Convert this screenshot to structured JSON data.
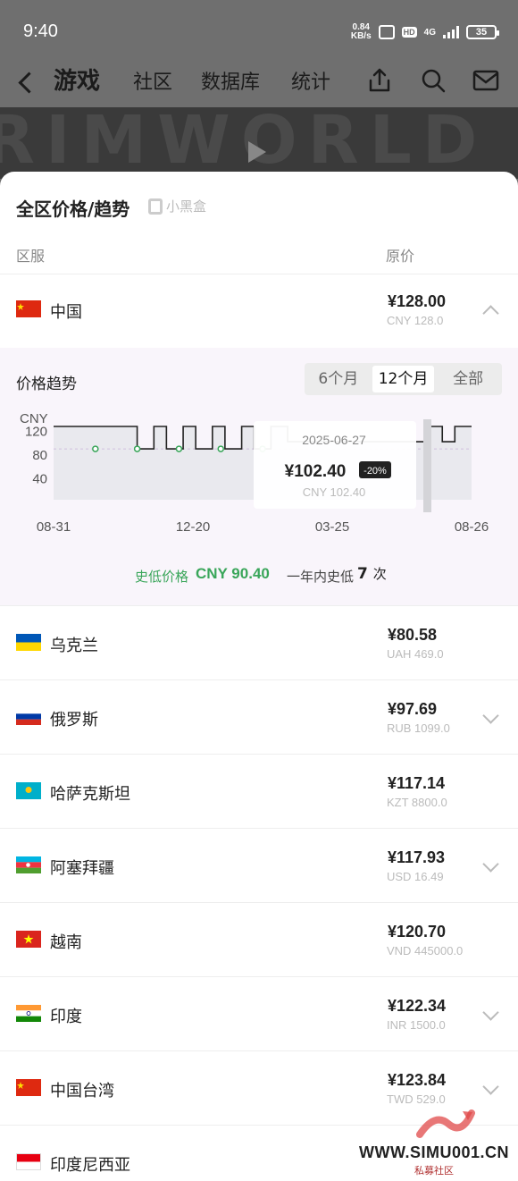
{
  "status_bar": {
    "time": "9:40",
    "net_speed_value": "0.84",
    "net_speed_unit": "KB/s",
    "network": "4G",
    "battery": "35"
  },
  "header": {
    "tabs": [
      {
        "label": "游戏",
        "active": true
      },
      {
        "label": "社区",
        "active": false
      },
      {
        "label": "数据库",
        "active": false
      },
      {
        "label": "统计",
        "active": false
      }
    ],
    "icons": [
      "share-icon",
      "search-icon",
      "mail-icon"
    ]
  },
  "banner": {
    "text": "RIMWORLD"
  },
  "sheet": {
    "title": "全区价格/趋势",
    "brand": "小黑盒",
    "col_region": "区服",
    "col_price": "原价"
  },
  "expanded_region": {
    "name": "中国",
    "price": "¥128.00",
    "orig": "CNY 128.0"
  },
  "trend": {
    "title": "价格趋势",
    "periods": [
      {
        "label": "6个月",
        "active": false
      },
      {
        "label": "12个月",
        "active": true
      },
      {
        "label": "全部",
        "active": false
      }
    ],
    "lowest_label": "史低价格",
    "lowest_value": "CNY 90.40",
    "count_label": "一年内史低",
    "count_value": "7",
    "count_unit": "次",
    "tooltip": {
      "date": "2025-06-27",
      "price": "¥102.40",
      "discount": "-20%",
      "orig": "CNY 102.40"
    }
  },
  "regions": [
    {
      "name": "乌克兰",
      "price": "¥80.58",
      "orig": "UAH 469.0",
      "flag": "ukraine",
      "chevron": false
    },
    {
      "name": "俄罗斯",
      "price": "¥97.69",
      "orig": "RUB 1099.0",
      "flag": "russia",
      "chevron": true
    },
    {
      "name": "哈萨克斯坦",
      "price": "¥117.14",
      "orig": "KZT 8800.0",
      "flag": "kazakhstan",
      "chevron": false
    },
    {
      "name": "阿塞拜疆",
      "price": "¥117.93",
      "orig": "USD 16.49",
      "flag": "azerbaijan",
      "chevron": true
    },
    {
      "name": "越南",
      "price": "¥120.70",
      "orig": "VND 445000.0",
      "flag": "vietnam",
      "chevron": false
    },
    {
      "name": "印度",
      "price": "¥122.34",
      "orig": "INR 1500.0",
      "flag": "india",
      "chevron": true
    },
    {
      "name": "中国台湾",
      "price": "¥123.84",
      "orig": "TWD 529.0",
      "flag": "china",
      "chevron": true
    },
    {
      "name": "印度尼西亚",
      "price": "",
      "orig": "",
      "flag": "indonesia",
      "chevron": false
    }
  ],
  "watermark": {
    "text": "WWW.SIMU001.CN",
    "sub": "私募社区"
  },
  "chart_data": {
    "type": "line",
    "ylabel": "CNY",
    "yticks": [
      40,
      80,
      120
    ],
    "ylim": [
      20,
      140
    ],
    "xticks": [
      "08-31",
      "12-20",
      "03-25",
      "08-26"
    ],
    "series": [
      {
        "x": [
          0,
          0.2,
          0.24,
          0.27,
          0.31,
          0.34,
          0.38,
          0.41,
          0.45,
          0.48,
          0.52,
          0.56,
          0.9,
          0.93,
          0.96,
          1
        ],
        "y": [
          128,
          90.4,
          128,
          90.4,
          128,
          90.4,
          128,
          90.4,
          128,
          90.4,
          128,
          102.4,
          128,
          102.4,
          128,
          128
        ]
      }
    ],
    "lowest_markers_x": [
      0.1,
      0.2,
      0.3,
      0.4,
      0.5
    ]
  }
}
